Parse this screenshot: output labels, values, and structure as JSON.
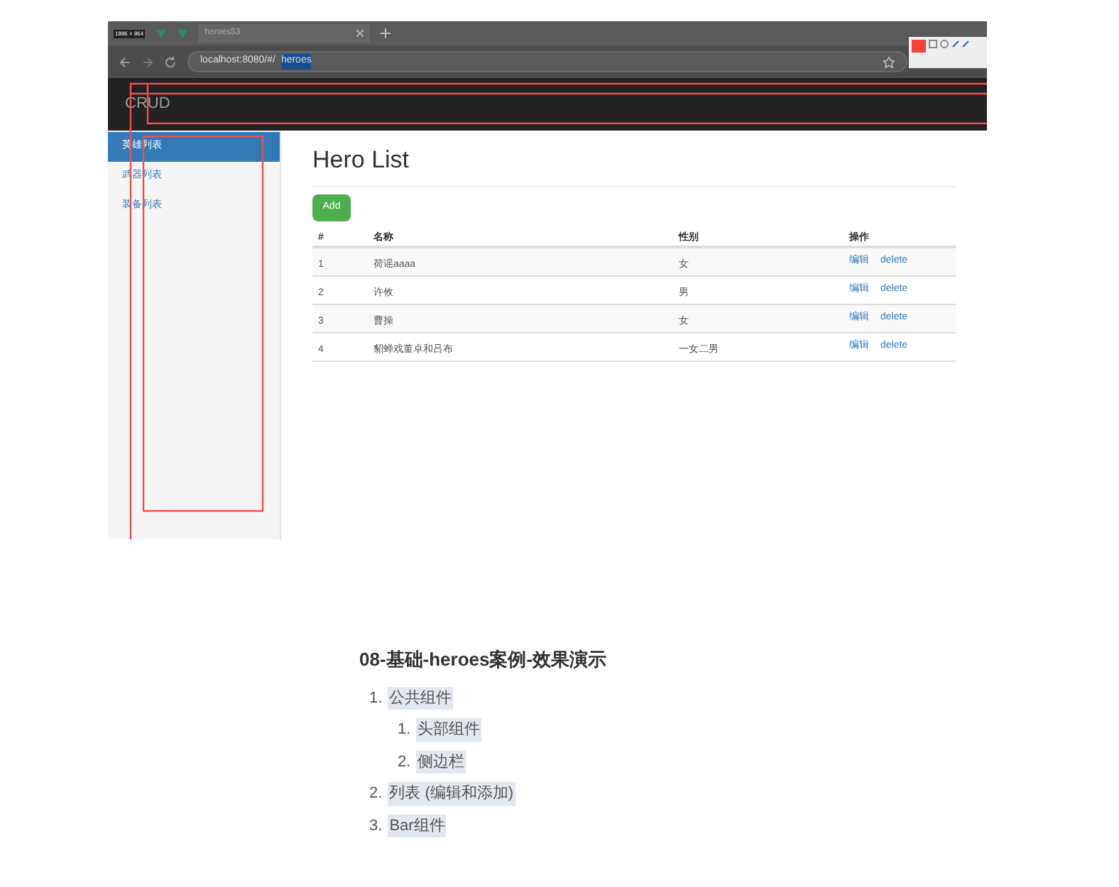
{
  "screenshot": {
    "resolution_label": "1896 × 964",
    "tab": {
      "title": "heroes53"
    },
    "address": {
      "text": "localhost:8080/#/",
      "selection": "heroes"
    },
    "navbar": {
      "brand": "CRUD"
    },
    "sidebar": {
      "items": [
        {
          "label": "英雄列表",
          "selected": true
        },
        {
          "label": "武器列表",
          "selected": false
        },
        {
          "label": "装备列表",
          "selected": false
        }
      ]
    },
    "main": {
      "title": "Hero List",
      "add_button": "Add",
      "table": {
        "columns": [
          "#",
          "名称",
          "性别",
          "操作"
        ],
        "rows": [
          {
            "cells": [
              "1",
              "荷谣aaaa",
              "女"
            ],
            "actions": [
              "编辑",
              "delete"
            ]
          },
          {
            "cells": [
              "2",
              "许攸",
              "男"
            ],
            "actions": [
              "编辑",
              "delete"
            ]
          },
          {
            "cells": [
              "3",
              "曹操",
              "女"
            ],
            "actions": [
              "编辑",
              "delete"
            ]
          },
          {
            "cells": [
              "4",
              "貂蝉戏董卓和吕布",
              "一女二男"
            ],
            "actions": [
              "编辑",
              "delete"
            ]
          }
        ]
      }
    }
  },
  "article": {
    "heading": "08-基础-heroes案例-效果演示",
    "list": [
      {
        "marker": "1.",
        "label": "公共组件",
        "children": [
          {
            "marker": "1.",
            "label": "头部组件"
          },
          {
            "marker": "2.",
            "label": "侧边栏"
          }
        ]
      },
      {
        "marker": "2.",
        "label": "列表 (编辑和添加)"
      },
      {
        "marker": "3.",
        "label": "Bar组件"
      }
    ]
  }
}
